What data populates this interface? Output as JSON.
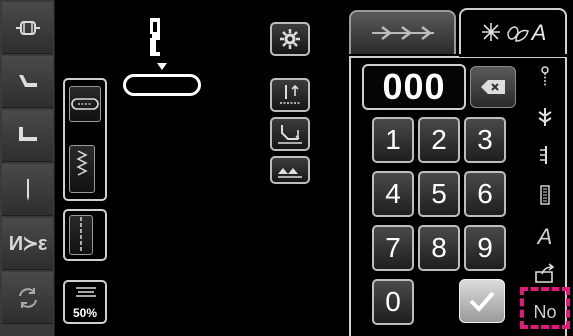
{
  "left_toolbar": {
    "items": [
      {
        "icon": "bobbin-winder-icon"
      },
      {
        "icon": "presser-foot-icon"
      },
      {
        "icon": "free-arm-icon"
      },
      {
        "icon": "needle-icon"
      },
      {
        "icon": "thread-cutter-icon",
        "label": "И≻ε"
      },
      {
        "icon": "reset-rotate-icon"
      }
    ]
  },
  "stitch_cards": [
    {
      "icon": "buttonhole-icon"
    },
    {
      "icon": "zigzag-stitch-icon"
    },
    {
      "icon": "straight-stitch-icon"
    },
    {
      "icon": "tension-icon",
      "value": "50%"
    }
  ],
  "mid_buttons": [
    {
      "icon": "settings-gear-icon"
    },
    {
      "icon": "needle-position-icon"
    },
    {
      "icon": "presser-foot-lift-icon"
    },
    {
      "icon": "feed-dogs-icon"
    }
  ],
  "tabs": {
    "threads_icon": "thread-arrows-icon",
    "pattern_label": "A"
  },
  "keypad": {
    "display": "000",
    "keys": [
      "1",
      "2",
      "3",
      "4",
      "5",
      "6",
      "7",
      "8",
      "9",
      "0"
    ]
  },
  "right_icons": [
    "thread-guide-icon",
    "needle-threader-icon",
    "stitch-length-icon",
    "stitch-ruler-icon",
    "font-a-icon",
    "folder-export-icon"
  ],
  "right_font_letter": "A",
  "no_button": {
    "label": "No"
  },
  "accent_color": "#e0187a"
}
